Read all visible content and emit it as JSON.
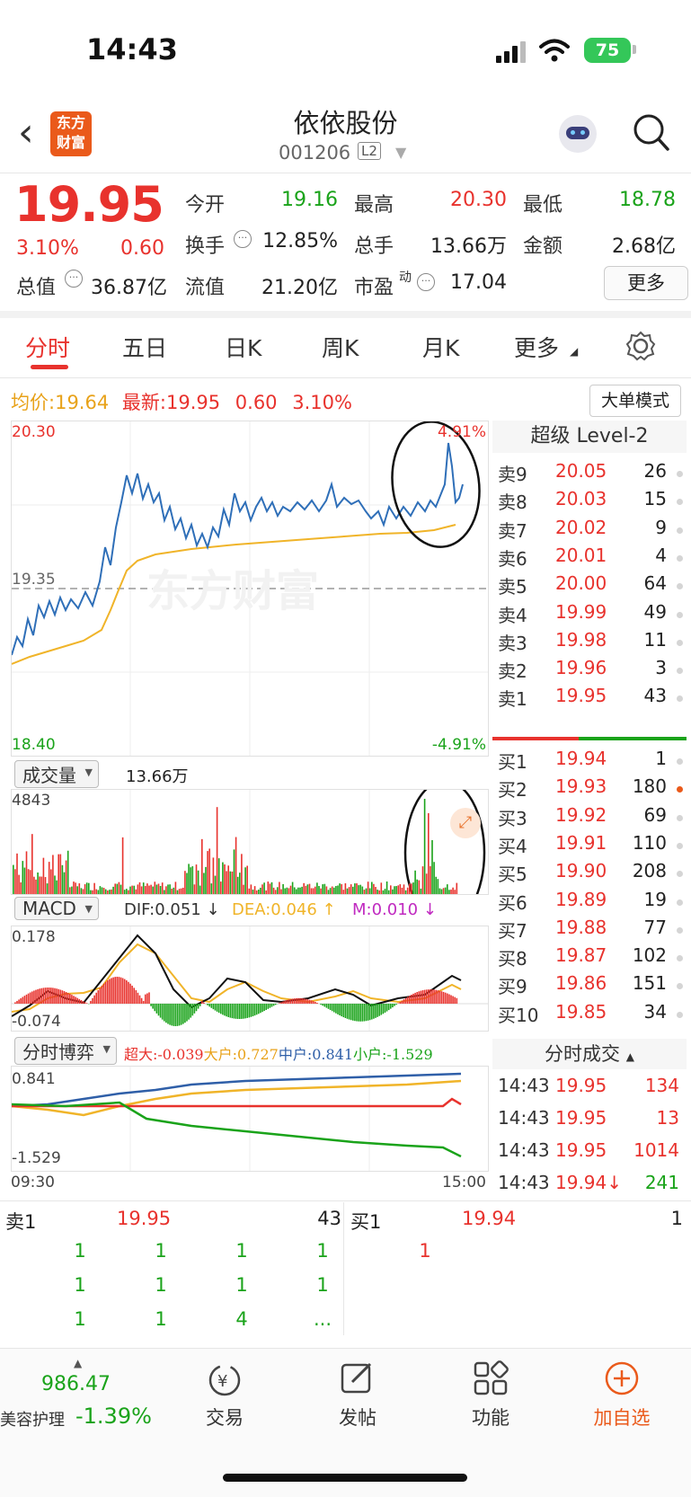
{
  "status_bar": {
    "time": "14:43",
    "battery": "75"
  },
  "header": {
    "logo_text": "东方财富",
    "title": "依依股份",
    "code": "001206",
    "level_badge": "L2"
  },
  "quote": {
    "price": "19.95",
    "change_pct": "3.10%",
    "change": "0.60",
    "fields": [
      {
        "label": "今开",
        "value": "19.16",
        "color": "green"
      },
      {
        "label": "最高",
        "value": "20.30",
        "color": "red"
      },
      {
        "label": "最低",
        "value": "18.78",
        "color": "green"
      },
      {
        "label": "换手",
        "value": "12.85%",
        "color": "black"
      },
      {
        "label": "总手",
        "value": "13.66万",
        "color": "black"
      },
      {
        "label": "金额",
        "value": "2.68亿",
        "color": "black"
      },
      {
        "label": "总值",
        "value": "36.87亿",
        "color": "black"
      },
      {
        "label": "流值",
        "value": "21.20亿",
        "color": "black"
      },
      {
        "label": "市盈",
        "label_sup": "动",
        "value": "17.04",
        "color": "black"
      }
    ],
    "more_label": "更多"
  },
  "tabs": [
    "分时",
    "五日",
    "日K",
    "周K",
    "月K",
    "更多"
  ],
  "price_line": {
    "avg_label": "均价:",
    "avg_value": "19.64",
    "last_label": "最新:",
    "last_value": "19.95",
    "last_change": "0.60",
    "last_pct": "3.10%",
    "big_order_label": "大单模式"
  },
  "main_chart": {
    "y_max": "20.30",
    "y_mid": "19.35",
    "y_min": "18.40",
    "pct_max": "4.91%",
    "pct_min": "-4.91%",
    "watermark": "东方财富"
  },
  "volume": {
    "selector": "成交量",
    "total": "13.66万",
    "max_label": "4843"
  },
  "macd": {
    "selector": "MACD",
    "dif": "DIF:0.051 ↓",
    "dea": "DEA:0.046 ↑",
    "m": "M:0.010 ↓",
    "y_max": "0.178",
    "y_min": "-0.074"
  },
  "game": {
    "selector": "分时博弈",
    "super": "超大:-0.039",
    "large": "大户:0.727",
    "mid": "中户:0.841",
    "small": "小户:-1.529",
    "y_max": "0.841",
    "y_min": "-1.529",
    "t_start": "09:30",
    "t_end": "15:00"
  },
  "order_book": {
    "title": "超级 Level-2",
    "asks": [
      {
        "label": "卖9",
        "price": "20.05",
        "vol": "26"
      },
      {
        "label": "卖8",
        "price": "20.03",
        "vol": "15"
      },
      {
        "label": "卖7",
        "price": "20.02",
        "vol": "9"
      },
      {
        "label": "卖6",
        "price": "20.01",
        "vol": "4"
      },
      {
        "label": "卖5",
        "price": "20.00",
        "vol": "64"
      },
      {
        "label": "卖4",
        "price": "19.99",
        "vol": "49"
      },
      {
        "label": "卖3",
        "price": "19.98",
        "vol": "11"
      },
      {
        "label": "卖2",
        "price": "19.96",
        "vol": "3"
      },
      {
        "label": "卖1",
        "price": "19.95",
        "vol": "43"
      }
    ],
    "bids": [
      {
        "label": "买1",
        "price": "19.94",
        "vol": "1"
      },
      {
        "label": "买2",
        "price": "19.93",
        "vol": "180"
      },
      {
        "label": "买3",
        "price": "19.92",
        "vol": "69"
      },
      {
        "label": "买4",
        "price": "19.91",
        "vol": "110"
      },
      {
        "label": "买5",
        "price": "19.90",
        "vol": "208"
      },
      {
        "label": "买6",
        "price": "19.89",
        "vol": "19"
      },
      {
        "label": "买7",
        "price": "19.88",
        "vol": "77"
      },
      {
        "label": "买8",
        "price": "19.87",
        "vol": "102"
      },
      {
        "label": "买9",
        "price": "19.86",
        "vol": "151"
      },
      {
        "label": "买10",
        "price": "19.85",
        "vol": "34"
      }
    ]
  },
  "trades": {
    "title": "分时成交",
    "rows": [
      {
        "time": "14:43",
        "price": "19.95",
        "vol": "134"
      },
      {
        "time": "14:43",
        "price": "19.95",
        "vol": "13"
      },
      {
        "time": "14:43",
        "price": "19.95",
        "vol": "1014"
      },
      {
        "time": "14:43",
        "price": "19.94↓",
        "vol": "241"
      }
    ]
  },
  "queue": {
    "ask_label": "卖1",
    "ask_price": "19.95",
    "ask_vol": "43",
    "bid_label": "买1",
    "bid_price": "19.94",
    "bid_vol": "1",
    "ask_rows": [
      [
        "1",
        "1",
        "1",
        "1"
      ],
      [
        "1",
        "1",
        "1",
        "1"
      ],
      [
        "1",
        "1",
        "4",
        "..."
      ]
    ],
    "bid_rows": [
      [
        "1"
      ]
    ]
  },
  "bottom_nav": {
    "index_value": "986.47",
    "index_name": "美容护理",
    "index_change": "-1.39%",
    "items": [
      "交易",
      "发帖",
      "功能",
      "加自选"
    ]
  }
}
